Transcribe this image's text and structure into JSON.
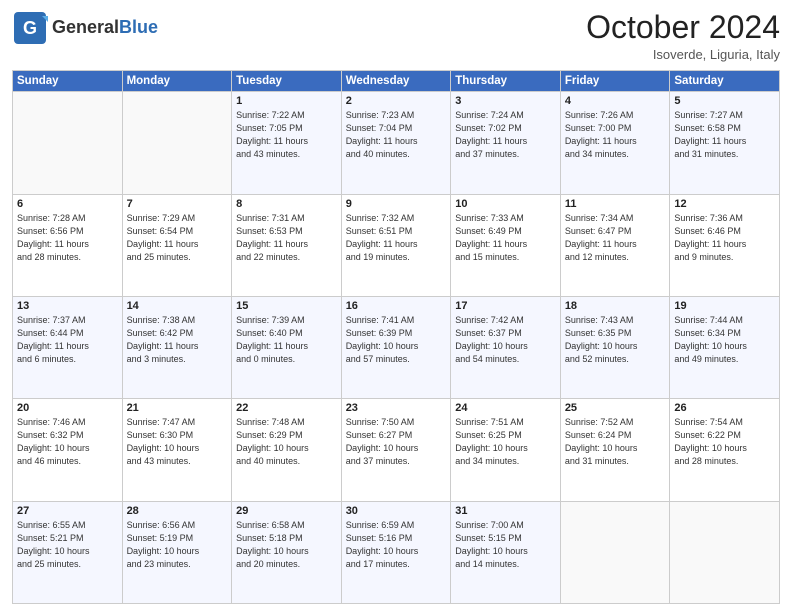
{
  "header": {
    "logo_general": "General",
    "logo_blue": "Blue",
    "month": "October 2024",
    "location": "Isoverde, Liguria, Italy"
  },
  "weekdays": [
    "Sunday",
    "Monday",
    "Tuesday",
    "Wednesday",
    "Thursday",
    "Friday",
    "Saturday"
  ],
  "weeks": [
    [
      {
        "day": "",
        "info": ""
      },
      {
        "day": "",
        "info": ""
      },
      {
        "day": "1",
        "info": "Sunrise: 7:22 AM\nSunset: 7:05 PM\nDaylight: 11 hours\nand 43 minutes."
      },
      {
        "day": "2",
        "info": "Sunrise: 7:23 AM\nSunset: 7:04 PM\nDaylight: 11 hours\nand 40 minutes."
      },
      {
        "day": "3",
        "info": "Sunrise: 7:24 AM\nSunset: 7:02 PM\nDaylight: 11 hours\nand 37 minutes."
      },
      {
        "day": "4",
        "info": "Sunrise: 7:26 AM\nSunset: 7:00 PM\nDaylight: 11 hours\nand 34 minutes."
      },
      {
        "day": "5",
        "info": "Sunrise: 7:27 AM\nSunset: 6:58 PM\nDaylight: 11 hours\nand 31 minutes."
      }
    ],
    [
      {
        "day": "6",
        "info": "Sunrise: 7:28 AM\nSunset: 6:56 PM\nDaylight: 11 hours\nand 28 minutes."
      },
      {
        "day": "7",
        "info": "Sunrise: 7:29 AM\nSunset: 6:54 PM\nDaylight: 11 hours\nand 25 minutes."
      },
      {
        "day": "8",
        "info": "Sunrise: 7:31 AM\nSunset: 6:53 PM\nDaylight: 11 hours\nand 22 minutes."
      },
      {
        "day": "9",
        "info": "Sunrise: 7:32 AM\nSunset: 6:51 PM\nDaylight: 11 hours\nand 19 minutes."
      },
      {
        "day": "10",
        "info": "Sunrise: 7:33 AM\nSunset: 6:49 PM\nDaylight: 11 hours\nand 15 minutes."
      },
      {
        "day": "11",
        "info": "Sunrise: 7:34 AM\nSunset: 6:47 PM\nDaylight: 11 hours\nand 12 minutes."
      },
      {
        "day": "12",
        "info": "Sunrise: 7:36 AM\nSunset: 6:46 PM\nDaylight: 11 hours\nand 9 minutes."
      }
    ],
    [
      {
        "day": "13",
        "info": "Sunrise: 7:37 AM\nSunset: 6:44 PM\nDaylight: 11 hours\nand 6 minutes."
      },
      {
        "day": "14",
        "info": "Sunrise: 7:38 AM\nSunset: 6:42 PM\nDaylight: 11 hours\nand 3 minutes."
      },
      {
        "day": "15",
        "info": "Sunrise: 7:39 AM\nSunset: 6:40 PM\nDaylight: 11 hours\nand 0 minutes."
      },
      {
        "day": "16",
        "info": "Sunrise: 7:41 AM\nSunset: 6:39 PM\nDaylight: 10 hours\nand 57 minutes."
      },
      {
        "day": "17",
        "info": "Sunrise: 7:42 AM\nSunset: 6:37 PM\nDaylight: 10 hours\nand 54 minutes."
      },
      {
        "day": "18",
        "info": "Sunrise: 7:43 AM\nSunset: 6:35 PM\nDaylight: 10 hours\nand 52 minutes."
      },
      {
        "day": "19",
        "info": "Sunrise: 7:44 AM\nSunset: 6:34 PM\nDaylight: 10 hours\nand 49 minutes."
      }
    ],
    [
      {
        "day": "20",
        "info": "Sunrise: 7:46 AM\nSunset: 6:32 PM\nDaylight: 10 hours\nand 46 minutes."
      },
      {
        "day": "21",
        "info": "Sunrise: 7:47 AM\nSunset: 6:30 PM\nDaylight: 10 hours\nand 43 minutes."
      },
      {
        "day": "22",
        "info": "Sunrise: 7:48 AM\nSunset: 6:29 PM\nDaylight: 10 hours\nand 40 minutes."
      },
      {
        "day": "23",
        "info": "Sunrise: 7:50 AM\nSunset: 6:27 PM\nDaylight: 10 hours\nand 37 minutes."
      },
      {
        "day": "24",
        "info": "Sunrise: 7:51 AM\nSunset: 6:25 PM\nDaylight: 10 hours\nand 34 minutes."
      },
      {
        "day": "25",
        "info": "Sunrise: 7:52 AM\nSunset: 6:24 PM\nDaylight: 10 hours\nand 31 minutes."
      },
      {
        "day": "26",
        "info": "Sunrise: 7:54 AM\nSunset: 6:22 PM\nDaylight: 10 hours\nand 28 minutes."
      }
    ],
    [
      {
        "day": "27",
        "info": "Sunrise: 6:55 AM\nSunset: 5:21 PM\nDaylight: 10 hours\nand 25 minutes."
      },
      {
        "day": "28",
        "info": "Sunrise: 6:56 AM\nSunset: 5:19 PM\nDaylight: 10 hours\nand 23 minutes."
      },
      {
        "day": "29",
        "info": "Sunrise: 6:58 AM\nSunset: 5:18 PM\nDaylight: 10 hours\nand 20 minutes."
      },
      {
        "day": "30",
        "info": "Sunrise: 6:59 AM\nSunset: 5:16 PM\nDaylight: 10 hours\nand 17 minutes."
      },
      {
        "day": "31",
        "info": "Sunrise: 7:00 AM\nSunset: 5:15 PM\nDaylight: 10 hours\nand 14 minutes."
      },
      {
        "day": "",
        "info": ""
      },
      {
        "day": "",
        "info": ""
      }
    ]
  ]
}
